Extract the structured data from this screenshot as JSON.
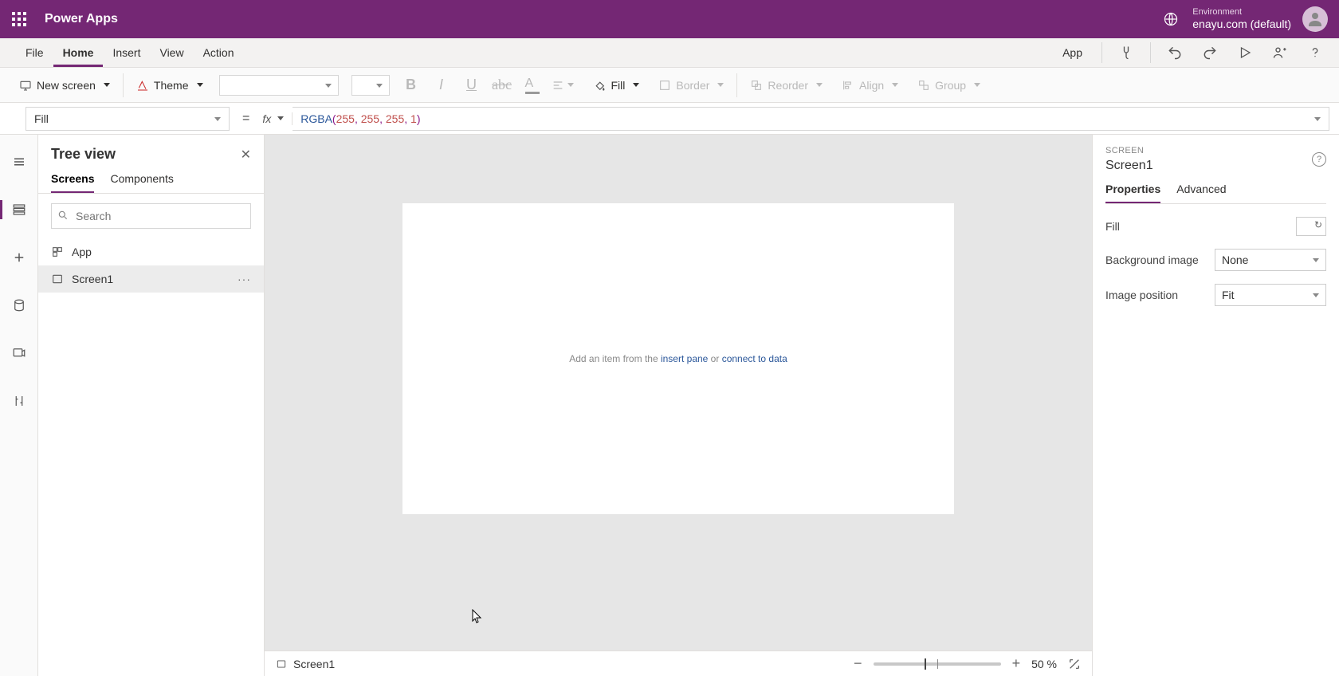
{
  "title": {
    "app": "Power Apps"
  },
  "env": {
    "label": "Environment",
    "name": "enayu.com (default)"
  },
  "menubar": {
    "file": "File",
    "home": "Home",
    "insert": "Insert",
    "view": "View",
    "action": "Action",
    "app": "App"
  },
  "ribbon": {
    "new_screen": "New screen",
    "theme": "Theme",
    "fill": "Fill",
    "border": "Border",
    "reorder": "Reorder",
    "align": "Align",
    "group": "Group"
  },
  "formula": {
    "property": "Fill",
    "fx": "fx",
    "fn": "RGBA",
    "args": [
      "255",
      "255",
      "255",
      "1"
    ]
  },
  "treeview": {
    "title": "Tree view",
    "tab_screens": "Screens",
    "tab_components": "Components",
    "search_placeholder": "Search",
    "item_app": "App",
    "item_screen": "Screen1"
  },
  "canvas": {
    "hint_prefix": "Add an item from the ",
    "hint_link1": "insert pane",
    "hint_mid": " or ",
    "hint_link2": "connect to data"
  },
  "statusbar": {
    "crumb": "Screen1",
    "zoom": "50",
    "pct": "%"
  },
  "props": {
    "caption": "SCREEN",
    "name": "Screen1",
    "tab_props": "Properties",
    "tab_adv": "Advanced",
    "fill": "Fill",
    "bg": "Background image",
    "bg_val": "None",
    "imgpos": "Image position",
    "imgpos_val": "Fit"
  }
}
